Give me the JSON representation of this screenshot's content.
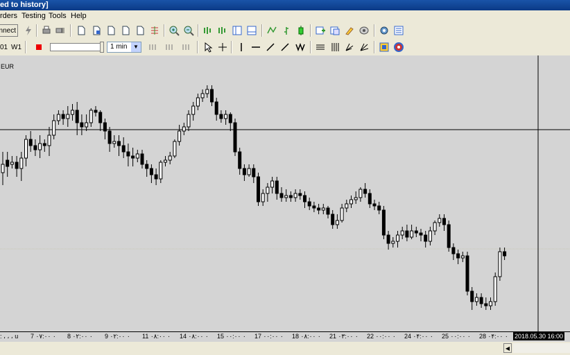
{
  "window": {
    "title": "ed to history]"
  },
  "menu": {
    "items": [
      "rders",
      "Testing",
      "Tools",
      "Help"
    ]
  },
  "toolbar": {
    "connect_label": "nnect"
  },
  "timeframes": {
    "labels": [
      "01",
      "W1"
    ],
    "selected": "1 min"
  },
  "chart": {
    "symbol": "EUR",
    "x_labels": [
      "‎:‎‎‎ ، ، ، ‎u",
      "7 ۰۷:۰۰ ۰",
      "8 ۰۲:۰۰ ۰",
      "9 ۰۲:۰۰ ۰",
      "11 ۰۸:۰۰ ۰",
      "14 ۰۸:۰۰ ۰",
      "15 ۰۰:۰۰ ۰",
      "17 ۰۰:۰۰ ۰",
      "18 ۰۸:۰۰ ۰",
      "21 ۰۳:۰۰ ۰",
      "22 ۰۰:۰۰ ۰",
      "24 ۰۴:۰۰ ۰",
      "25 ۰۰:۰۰ ۰",
      "28 ۰۴:۰۰ ۰"
    ],
    "current_time": "2018.05.30 16:00",
    "candles": [
      {
        "o": 42,
        "c": 46,
        "h": 36,
        "l": 52
      },
      {
        "o": 48,
        "c": 45,
        "h": 40,
        "l": 52
      },
      {
        "o": 46,
        "c": 47,
        "h": 44,
        "l": 50
      },
      {
        "o": 47,
        "c": 44,
        "h": 40,
        "l": 50
      },
      {
        "o": 44,
        "c": 49,
        "h": 38,
        "l": 52
      },
      {
        "o": 49,
        "c": 58,
        "h": 45,
        "l": 60
      },
      {
        "o": 58,
        "c": 55,
        "h": 52,
        "l": 62
      },
      {
        "o": 55,
        "c": 53,
        "h": 50,
        "l": 58
      },
      {
        "o": 53,
        "c": 56,
        "h": 49,
        "l": 60
      },
      {
        "o": 56,
        "c": 55,
        "h": 52,
        "l": 58
      },
      {
        "o": 55,
        "c": 60,
        "h": 50,
        "l": 64
      },
      {
        "o": 60,
        "c": 67,
        "h": 58,
        "l": 70
      },
      {
        "o": 67,
        "c": 70,
        "h": 65,
        "l": 72
      },
      {
        "o": 70,
        "c": 68,
        "h": 65,
        "l": 72
      },
      {
        "o": 68,
        "c": 70,
        "h": 64,
        "l": 74
      },
      {
        "o": 70,
        "c": 72,
        "h": 67,
        "l": 75
      },
      {
        "o": 72,
        "c": 66,
        "h": 60,
        "l": 76
      },
      {
        "o": 66,
        "c": 64,
        "h": 60,
        "l": 70
      },
      {
        "o": 64,
        "c": 66,
        "h": 62,
        "l": 70
      },
      {
        "o": 66,
        "c": 72,
        "h": 64,
        "l": 73
      },
      {
        "o": 72,
        "c": 71,
        "h": 69,
        "l": 74
      },
      {
        "o": 71,
        "c": 66,
        "h": 62,
        "l": 72
      },
      {
        "o": 66,
        "c": 62,
        "h": 58,
        "l": 68
      },
      {
        "o": 62,
        "c": 56,
        "h": 52,
        "l": 64
      },
      {
        "o": 56,
        "c": 57,
        "h": 54,
        "l": 60
      },
      {
        "o": 57,
        "c": 55,
        "h": 50,
        "l": 60
      },
      {
        "o": 55,
        "c": 52,
        "h": 49,
        "l": 59
      },
      {
        "o": 52,
        "c": 50,
        "h": 45,
        "l": 56
      },
      {
        "o": 50,
        "c": 49,
        "h": 45,
        "l": 54
      },
      {
        "o": 49,
        "c": 51,
        "h": 47,
        "l": 53
      },
      {
        "o": 51,
        "c": 46,
        "h": 44,
        "l": 53
      },
      {
        "o": 46,
        "c": 44,
        "h": 40,
        "l": 48
      },
      {
        "o": 44,
        "c": 41,
        "h": 37,
        "l": 46
      },
      {
        "o": 41,
        "c": 39,
        "h": 36,
        "l": 44
      },
      {
        "o": 39,
        "c": 47,
        "h": 37,
        "l": 48
      },
      {
        "o": 47,
        "c": 48,
        "h": 45,
        "l": 50
      },
      {
        "o": 48,
        "c": 50,
        "h": 46,
        "l": 52
      },
      {
        "o": 50,
        "c": 57,
        "h": 49,
        "l": 58
      },
      {
        "o": 57,
        "c": 62,
        "h": 55,
        "l": 65
      },
      {
        "o": 62,
        "c": 64,
        "h": 60,
        "l": 66
      },
      {
        "o": 64,
        "c": 70,
        "h": 62,
        "l": 72
      },
      {
        "o": 70,
        "c": 74,
        "h": 67,
        "l": 76
      },
      {
        "o": 74,
        "c": 78,
        "h": 72,
        "l": 80
      },
      {
        "o": 78,
        "c": 80,
        "h": 76,
        "l": 82
      },
      {
        "o": 80,
        "c": 82,
        "h": 78,
        "l": 84
      },
      {
        "o": 82,
        "c": 76,
        "h": 74,
        "l": 84
      },
      {
        "o": 76,
        "c": 70,
        "h": 67,
        "l": 78
      },
      {
        "o": 70,
        "c": 68,
        "h": 66,
        "l": 72
      },
      {
        "o": 68,
        "c": 70,
        "h": 65,
        "l": 72
      },
      {
        "o": 70,
        "c": 66,
        "h": 62,
        "l": 71
      },
      {
        "o": 66,
        "c": 52,
        "h": 50,
        "l": 68
      },
      {
        "o": 52,
        "c": 44,
        "h": 41,
        "l": 54
      },
      {
        "o": 44,
        "c": 41,
        "h": 38,
        "l": 46
      },
      {
        "o": 41,
        "c": 44,
        "h": 40,
        "l": 46
      },
      {
        "o": 44,
        "c": 40,
        "h": 37,
        "l": 46
      },
      {
        "o": 40,
        "c": 28,
        "h": 26,
        "l": 42
      },
      {
        "o": 28,
        "c": 32,
        "h": 26,
        "l": 34
      },
      {
        "o": 32,
        "c": 35,
        "h": 28,
        "l": 37
      },
      {
        "o": 35,
        "c": 38,
        "h": 32,
        "l": 40
      },
      {
        "o": 38,
        "c": 32,
        "h": 29,
        "l": 40
      },
      {
        "o": 32,
        "c": 30,
        "h": 28,
        "l": 35
      },
      {
        "o": 30,
        "c": 31,
        "h": 28,
        "l": 34
      },
      {
        "o": 31,
        "c": 30,
        "h": 28,
        "l": 33
      },
      {
        "o": 30,
        "c": 32,
        "h": 28,
        "l": 34
      },
      {
        "o": 32,
        "c": 31,
        "h": 29,
        "l": 34
      },
      {
        "o": 31,
        "c": 28,
        "h": 25,
        "l": 33
      },
      {
        "o": 28,
        "c": 26,
        "h": 24,
        "l": 30
      },
      {
        "o": 26,
        "c": 25,
        "h": 23,
        "l": 28
      },
      {
        "o": 25,
        "c": 24,
        "h": 22,
        "l": 27
      },
      {
        "o": 24,
        "c": 25,
        "h": 22,
        "l": 27
      },
      {
        "o": 25,
        "c": 22,
        "h": 20,
        "l": 26
      },
      {
        "o": 22,
        "c": 17,
        "h": 15,
        "l": 24
      },
      {
        "o": 17,
        "c": 19,
        "h": 15,
        "l": 22
      },
      {
        "o": 19,
        "c": 25,
        "h": 18,
        "l": 27
      },
      {
        "o": 25,
        "c": 27,
        "h": 23,
        "l": 29
      },
      {
        "o": 27,
        "c": 29,
        "h": 25,
        "l": 31
      },
      {
        "o": 29,
        "c": 30,
        "h": 27,
        "l": 33
      },
      {
        "o": 30,
        "c": 34,
        "h": 28,
        "l": 35
      },
      {
        "o": 34,
        "c": 32,
        "h": 30,
        "l": 37
      },
      {
        "o": 32,
        "c": 27,
        "h": 25,
        "l": 34
      },
      {
        "o": 27,
        "c": 26,
        "h": 24,
        "l": 29
      },
      {
        "o": 26,
        "c": 24,
        "h": 22,
        "l": 28
      },
      {
        "o": 24,
        "c": 12,
        "h": 10,
        "l": 26
      },
      {
        "o": 12,
        "c": 8,
        "h": 5,
        "l": 14
      },
      {
        "o": 8,
        "c": 9,
        "h": 6,
        "l": 11
      },
      {
        "o": 9,
        "c": 12,
        "h": 6,
        "l": 14
      },
      {
        "o": 12,
        "c": 14,
        "h": 10,
        "l": 16
      },
      {
        "o": 14,
        "c": 11,
        "h": 9,
        "l": 17
      },
      {
        "o": 11,
        "c": 14,
        "h": 10,
        "l": 17
      },
      {
        "o": 14,
        "c": 13,
        "h": 11,
        "l": 16
      },
      {
        "o": 13,
        "c": 12,
        "h": 9,
        "l": 15
      },
      {
        "o": 12,
        "c": 9,
        "h": 6,
        "l": 14
      },
      {
        "o": 9,
        "c": 14,
        "h": 7,
        "l": 16
      },
      {
        "o": 14,
        "c": 18,
        "h": 12,
        "l": 19
      },
      {
        "o": 18,
        "c": 20,
        "h": 16,
        "l": 22
      },
      {
        "o": 20,
        "c": 17,
        "h": 14,
        "l": 22
      },
      {
        "o": 17,
        "c": 6,
        "h": 4,
        "l": 19
      },
      {
        "o": 6,
        "c": 3,
        "h": 0,
        "l": 8
      },
      {
        "o": 3,
        "c": 1,
        "h": -2,
        "l": 5
      },
      {
        "o": 1,
        "c": 2,
        "h": -1,
        "l": 4
      },
      {
        "o": 2,
        "c": -15,
        "h": -17,
        "l": 4
      },
      {
        "o": -15,
        "c": -20,
        "h": -24,
        "l": -13
      },
      {
        "o": -20,
        "c": -18,
        "h": -22,
        "l": -16
      },
      {
        "o": -18,
        "c": -21,
        "h": -23,
        "l": -16
      },
      {
        "o": -21,
        "c": -22,
        "h": -24,
        "l": -18
      },
      {
        "o": -22,
        "c": -20,
        "h": -24,
        "l": -18
      },
      {
        "o": -20,
        "c": -8,
        "h": -22,
        "l": -6
      },
      {
        "o": -8,
        "c": 4,
        "h": -10,
        "l": 6
      },
      {
        "o": 4,
        "c": 2,
        "h": 0,
        "l": 6
      }
    ]
  }
}
